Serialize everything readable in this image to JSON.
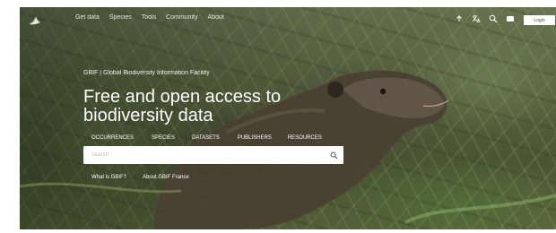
{
  "nav": {
    "logo_icon": "gbif-leaf-logo-icon",
    "links": [
      "Get data",
      "Species",
      "Tools",
      "Community",
      "About"
    ],
    "tools": [
      {
        "name": "upload-icon",
        "label": "Share"
      },
      {
        "name": "translate-icon",
        "label": "Language"
      },
      {
        "name": "search-icon",
        "label": "Search"
      },
      {
        "name": "notifications-icon",
        "label": "Notifications"
      }
    ],
    "login_label": "Login"
  },
  "hero": {
    "subtitle": "GBIF | Global Biodiversity Information Facility",
    "headline_line1": "Free and open access to",
    "headline_line2": "biodiversity data"
  },
  "search": {
    "tabs": [
      "OCCURRENCES",
      "SPECIES",
      "DATASETS",
      "PUBLISHERS",
      "RESOURCES"
    ],
    "placeholder": "Search",
    "button_icon": "search-icon"
  },
  "quick_links": [
    "What is GBIF?",
    "About GBIF France"
  ],
  "colors": {
    "text_on_image": "#ffffff",
    "login_background": "#ffffff",
    "search_background": "#ffffff"
  }
}
